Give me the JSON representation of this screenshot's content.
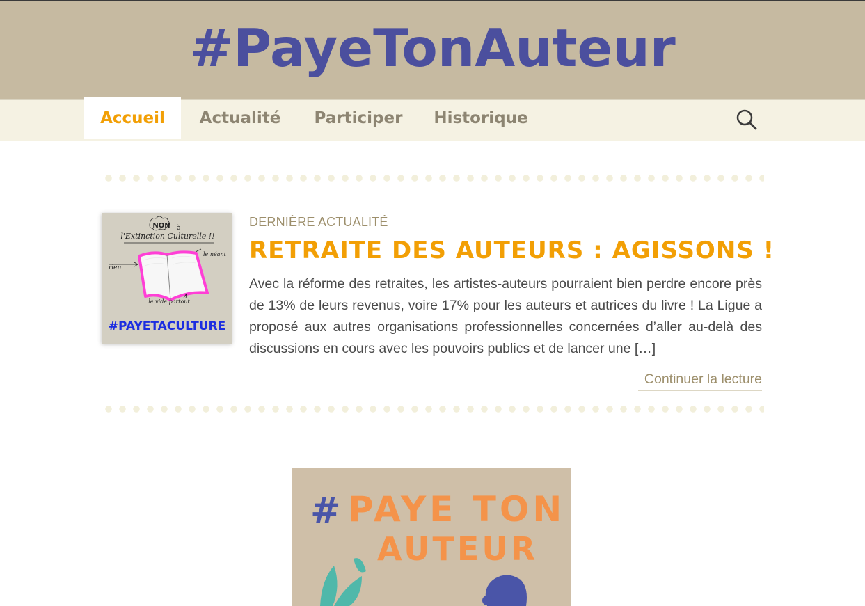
{
  "header": {
    "site_title": "#PayeTonAuteur"
  },
  "nav": {
    "items": [
      {
        "label": "Accueil"
      },
      {
        "label": "Actualité"
      },
      {
        "label": "Participer"
      },
      {
        "label": "Historique"
      }
    ],
    "active_label": "Accueil"
  },
  "featured": {
    "kicker": "DERNIÈRE ACTUALITÉ",
    "title": "RETRAITE DES AUTEURS : AGISSONS !",
    "excerpt": " Avec la réforme des retraites, les artistes-auteurs pourraient bien perdre encore près de 13% de leurs revenus, voire 17% pour les auteurs et autrices du livre ! La Ligue a proposé aux autres organisations professionnelles concernées d’aller au-delà des discussions en cours avec les pouvoirs publics et de lancer une  […]",
    "read_more": "Continuer la lecture",
    "thumbnail": {
      "note_top": "NON",
      "note_a": "à",
      "note_line": "l'Extinction Culturelle !!",
      "note_left": "rien",
      "note_right": "le néant",
      "note_bottom": "le vide partout",
      "hashtag": "#PAYETACULTURE"
    }
  },
  "banner": {
    "hash": "#",
    "line1": "PAYE TON",
    "line2": "AUTEUR"
  },
  "colors": {
    "header_bg": "#c6baa1",
    "title_color": "#4b4f9e",
    "nav_bg": "#f5f2e3",
    "accent": "#f29f05",
    "muted": "#8d8572"
  }
}
